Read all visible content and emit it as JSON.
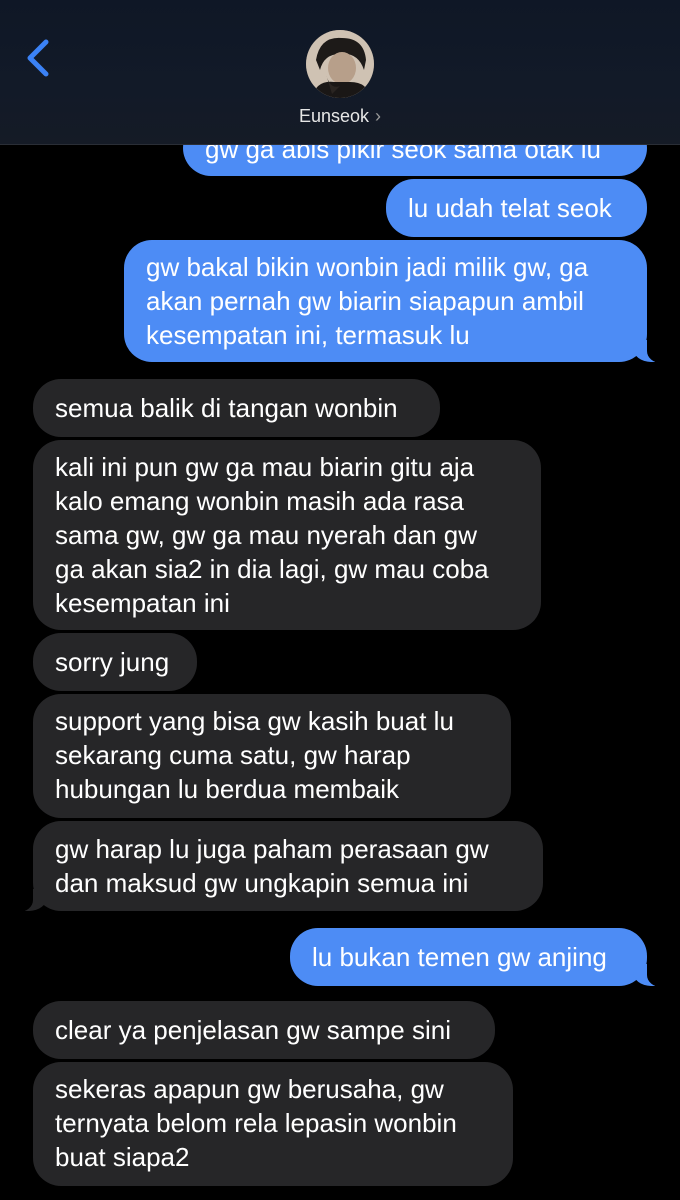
{
  "header": {
    "contact_name": "Eunseok",
    "chevron": "›",
    "back_icon": "chevron-left-icon",
    "accent_color": "#3b82f6"
  },
  "colors": {
    "outgoing_bubble": "#4d8cf5",
    "incoming_bubble": "#262628",
    "background": "#000000"
  },
  "messages": [
    {
      "dir": "out",
      "lines": [
        "gw ga abis pikir seok sama otak lu"
      ]
    },
    {
      "dir": "out",
      "lines": [
        "lu udah telat seok"
      ]
    },
    {
      "dir": "out",
      "lines": [
        "gw bakal bikin wonbin jadi milik gw, ga",
        "akan pernah gw biarin siapapun ambil",
        "kesempatan ini, termasuk lu"
      ]
    },
    {
      "dir": "in",
      "lines": [
        "semua balik di tangan wonbin"
      ]
    },
    {
      "dir": "in",
      "lines": [
        "kali ini pun gw ga mau biarin gitu aja",
        "kalo emang wonbin masih ada rasa",
        "sama gw, gw ga mau nyerah dan gw",
        "ga akan sia2 in dia lagi, gw mau coba",
        "kesempatan ini"
      ]
    },
    {
      "dir": "in",
      "lines": [
        "sorry jung"
      ]
    },
    {
      "dir": "in",
      "lines": [
        "support yang bisa gw kasih buat lu",
        "sekarang cuma satu, gw harap",
        "hubungan lu berdua membaik"
      ]
    },
    {
      "dir": "in",
      "lines": [
        "gw harap lu juga paham perasaan gw",
        "dan maksud gw ungkapin semua ini"
      ]
    },
    {
      "dir": "out",
      "lines": [
        "lu bukan temen gw anjing"
      ]
    },
    {
      "dir": "in",
      "lines": [
        "clear ya penjelasan gw sampe sini"
      ]
    },
    {
      "dir": "in",
      "lines": [
        "sekeras apapun gw berusaha, gw",
        "ternyata belom rela lepasin wonbin",
        "buat siapa2"
      ]
    }
  ]
}
